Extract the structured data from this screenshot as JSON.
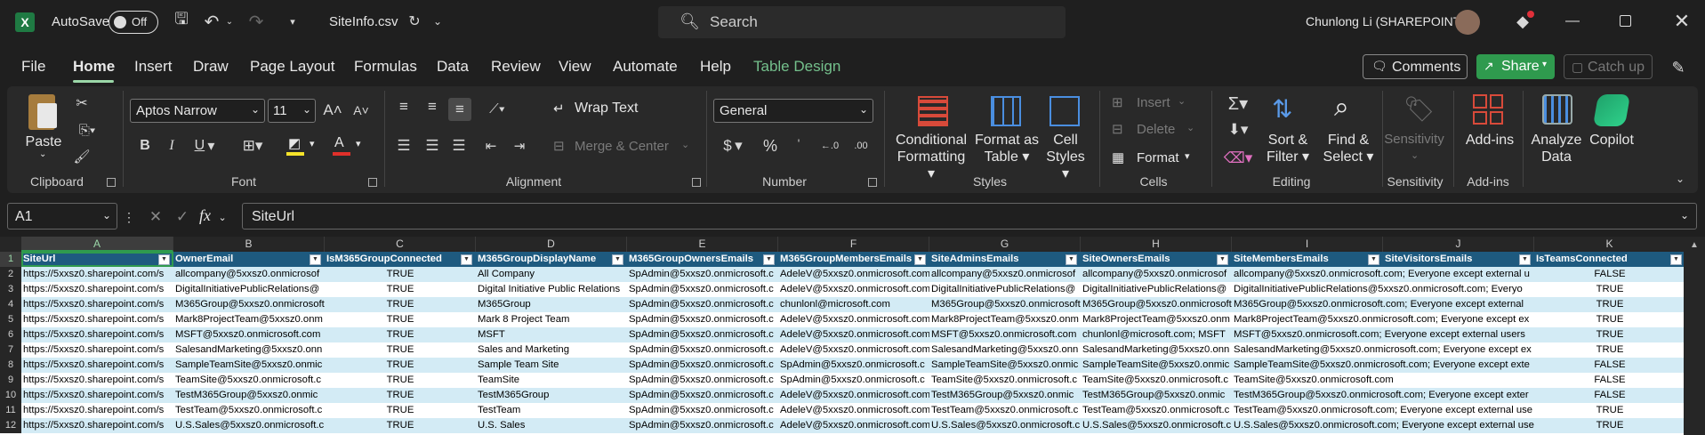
{
  "titlebar": {
    "autosave_label": "AutoSave",
    "autosave_state": "Off",
    "filename": "SiteInfo.csv",
    "search_placeholder": "Search",
    "user_name": "Chunlong Li (SHAREPOINT)"
  },
  "tabs": [
    "File",
    "Home",
    "Insert",
    "Draw",
    "Page Layout",
    "Formulas",
    "Data",
    "Review",
    "View",
    "Automate",
    "Help",
    "Table Design"
  ],
  "tab_actions": {
    "comments": "Comments",
    "share": "Share",
    "catchup": "Catch up"
  },
  "ribbon": {
    "clipboard": {
      "paste": "Paste",
      "group": "Clipboard"
    },
    "font": {
      "name": "Aptos Narrow",
      "size": "11",
      "group": "Font"
    },
    "alignment": {
      "wrap": "Wrap Text",
      "merge": "Merge & Center",
      "group": "Alignment"
    },
    "number": {
      "format": "General",
      "group": "Number"
    },
    "styles": {
      "cond1": "Conditional",
      "cond2": "Formatting",
      "fmt1": "Format as",
      "fmt2": "Table",
      "cell1": "Cell",
      "cell2": "Styles",
      "group": "Styles"
    },
    "cells": {
      "insert": "Insert",
      "delete": "Delete",
      "format": "Format",
      "group": "Cells"
    },
    "editing": {
      "sort1": "Sort &",
      "sort2": "Filter",
      "find1": "Find &",
      "find2": "Select",
      "group": "Editing"
    },
    "sensitivity": {
      "label": "Sensitivity",
      "group": "Sensitivity"
    },
    "addins": {
      "label": "Add-ins",
      "group": "Add-ins"
    },
    "analyze": {
      "l1": "Analyze",
      "l2": "Data"
    },
    "copilot": {
      "label": "Copilot"
    }
  },
  "formula_bar": {
    "namebox": "A1",
    "fx": "fx",
    "value": "SiteUrl"
  },
  "columns": [
    "A",
    "B",
    "C",
    "D",
    "E",
    "F",
    "G",
    "H",
    "I",
    "J",
    "K"
  ],
  "headers": [
    "SiteUrl",
    "OwnerEmail",
    "IsM365GroupConnected",
    "M365GroupDisplayName",
    "M365GroupOwnersEmails",
    "M365GroupMembersEmails",
    "SiteAdminsEmails",
    "SiteOwnersEmails",
    "SiteMembersEmails",
    "SiteVisitorsEmails",
    "IsTeamsConnected"
  ],
  "row_numbers": [
    "1",
    "2",
    "3",
    "4",
    "5",
    "6",
    "7",
    "8",
    "9",
    "10",
    "11",
    "12"
  ],
  "rows": [
    [
      "https://5xxsz0.sharepoint.com/s",
      "allcompany@5xxsz0.onmicrosof",
      "TRUE",
      "All Company",
      "SpAdmin@5xxsz0.onmicrosoft.c",
      "AdeleV@5xxsz0.onmicrosoft.com",
      "allcompany@5xxsz0.onmicrosof",
      "allcompany@5xxsz0.onmicrosof",
      "allcompany@5xxsz0.onmicrosoft.com; Everyone except external u",
      "",
      "FALSE"
    ],
    [
      "https://5xxsz0.sharepoint.com/s",
      "DigitalInitiativePublicRelations@",
      "TRUE",
      "Digital Initiative Public Relations",
      "SpAdmin@5xxsz0.onmicrosoft.c",
      "AdeleV@5xxsz0.onmicrosoft.com",
      "DigitalInitiativePublicRelations@",
      "DigitalInitiativePublicRelations@",
      "DigitalInitiativePublicRelations@5xxsz0.onmicrosoft.com; Everyo",
      "",
      "TRUE"
    ],
    [
      "https://5xxsz0.sharepoint.com/s",
      "M365Group@5xxsz0.onmicrosoft",
      "TRUE",
      "M365Group",
      "SpAdmin@5xxsz0.onmicrosoft.c",
      "chunlonl@microsoft.com",
      "M365Group@5xxsz0.onmicrosoft",
      "M365Group@5xxsz0.onmicrosoft",
      "M365Group@5xxsz0.onmicrosoft.com; Everyone except external",
      "",
      "TRUE"
    ],
    [
      "https://5xxsz0.sharepoint.com/s",
      "Mark8ProjectTeam@5xxsz0.onm",
      "TRUE",
      "Mark 8 Project Team",
      "SpAdmin@5xxsz0.onmicrosoft.c",
      "AdeleV@5xxsz0.onmicrosoft.com",
      "Mark8ProjectTeam@5xxsz0.onm",
      "Mark8ProjectTeam@5xxsz0.onm",
      "Mark8ProjectTeam@5xxsz0.onmicrosoft.com; Everyone except ex",
      "",
      "TRUE"
    ],
    [
      "https://5xxsz0.sharepoint.com/s",
      "MSFT@5xxsz0.onmicrosoft.com",
      "TRUE",
      "MSFT",
      "SpAdmin@5xxsz0.onmicrosoft.c",
      "AdeleV@5xxsz0.onmicrosoft.com",
      "MSFT@5xxsz0.onmicrosoft.com",
      "chunlonl@microsoft.com; MSFT",
      "MSFT@5xxsz0.onmicrosoft.com; Everyone except external users",
      "",
      "TRUE"
    ],
    [
      "https://5xxsz0.sharepoint.com/s",
      "SalesandMarketing@5xxsz0.onn",
      "TRUE",
      "Sales and Marketing",
      "SpAdmin@5xxsz0.onmicrosoft.c",
      "AdeleV@5xxsz0.onmicrosoft.com",
      "SalesandMarketing@5xxsz0.onn",
      "SalesandMarketing@5xxsz0.onn",
      "SalesandMarketing@5xxsz0.onmicrosoft.com; Everyone except ex",
      "",
      "TRUE"
    ],
    [
      "https://5xxsz0.sharepoint.com/s",
      "SampleTeamSite@5xxsz0.onmic",
      "TRUE",
      "Sample Team Site",
      "SpAdmin@5xxsz0.onmicrosoft.c",
      "SpAdmin@5xxsz0.onmicrosoft.c",
      "SampleTeamSite@5xxsz0.onmic",
      "SampleTeamSite@5xxsz0.onmic",
      "SampleTeamSite@5xxsz0.onmicrosoft.com; Everyone except exte",
      "",
      "FALSE"
    ],
    [
      "https://5xxsz0.sharepoint.com/s",
      "TeamSite@5xxsz0.onmicrosoft.c",
      "TRUE",
      "TeamSite",
      "SpAdmin@5xxsz0.onmicrosoft.c",
      "SpAdmin@5xxsz0.onmicrosoft.c",
      "TeamSite@5xxsz0.onmicrosoft.c",
      "TeamSite@5xxsz0.onmicrosoft.c",
      "TeamSite@5xxsz0.onmicrosoft.com",
      "",
      "FALSE"
    ],
    [
      "https://5xxsz0.sharepoint.com/s",
      "TestM365Group@5xxsz0.onmic",
      "TRUE",
      "TestM365Group",
      "SpAdmin@5xxsz0.onmicrosoft.c",
      "AdeleV@5xxsz0.onmicrosoft.com",
      "TestM365Group@5xxsz0.onmic",
      "TestM365Group@5xxsz0.onmic",
      "TestM365Group@5xxsz0.onmicrosoft.com; Everyone except exter",
      "",
      "FALSE"
    ],
    [
      "https://5xxsz0.sharepoint.com/s",
      "TestTeam@5xxsz0.onmicrosoft.c",
      "TRUE",
      "TestTeam",
      "SpAdmin@5xxsz0.onmicrosoft.c",
      "AdeleV@5xxsz0.onmicrosoft.com",
      "TestTeam@5xxsz0.onmicrosoft.c",
      "TestTeam@5xxsz0.onmicrosoft.c",
      "TestTeam@5xxsz0.onmicrosoft.com; Everyone except external use",
      "",
      "TRUE"
    ],
    [
      "https://5xxsz0.sharepoint.com/s",
      "U.S.Sales@5xxsz0.onmicrosoft.c",
      "TRUE",
      "U.S. Sales",
      "SpAdmin@5xxsz0.onmicrosoft.c",
      "AdeleV@5xxsz0.onmicrosoft.com",
      "U.S.Sales@5xxsz0.onmicrosoft.c",
      "U.S.Sales@5xxsz0.onmicrosoft.c",
      "U.S.Sales@5xxsz0.onmicrosoft.com; Everyone except external use",
      "",
      "TRUE"
    ]
  ],
  "colors": {
    "header_fill": "#1e5a7f",
    "band": "#d3ebf5",
    "accent_green": "#2f9a4e",
    "table_design": "#74c08c"
  }
}
